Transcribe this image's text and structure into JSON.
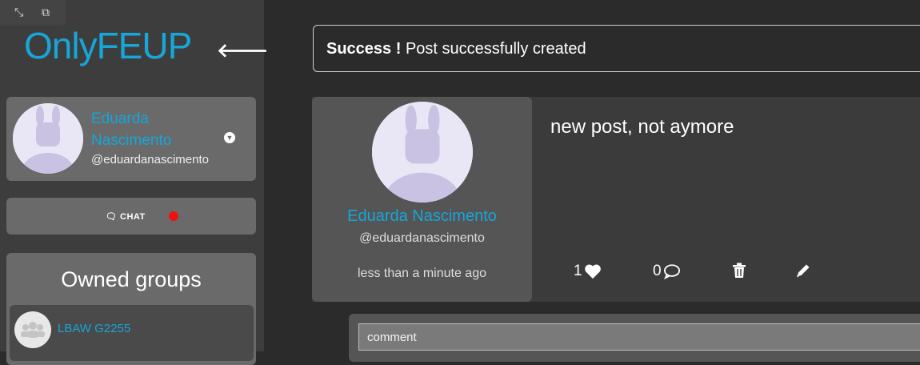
{
  "window_controls": {
    "expand_icon": "expand-icon",
    "picture_in_picture_icon": "pip-icon"
  },
  "sidebar": {
    "logo": "OnlyFEUP",
    "back_icon": "arrow-left-icon",
    "profile": {
      "name": "Eduarda Nascimento",
      "handle": "@eduardanascimento",
      "menu_icon": "chevron-down-icon"
    },
    "chat": {
      "label": "CHAT",
      "icon": "chat-bubble-icon",
      "notification_color": "#ee1111"
    },
    "groups": {
      "title": "Owned groups",
      "items": [
        {
          "name": "LBAW G2255",
          "icon": "group-icon"
        }
      ]
    }
  },
  "alert": {
    "strong": "Success !",
    "message": "Post successfully created"
  },
  "post": {
    "author": {
      "name": "Eduarda Nascimento",
      "handle": "@eduardanascimento"
    },
    "time": "less than a minute ago",
    "content": "new post, not aymore",
    "likes": "1",
    "comments": "0",
    "like_icon": "heart-icon",
    "comment_icon": "comment-icon",
    "delete_icon": "trash-icon",
    "edit_icon": "pencil-icon"
  },
  "comment_box": {
    "placeholder": "comment"
  },
  "colors": {
    "accent": "#16a6d8",
    "background": "#2b2b2b",
    "sidebar": "#3d3d3d",
    "card": "#6a6a6a"
  }
}
